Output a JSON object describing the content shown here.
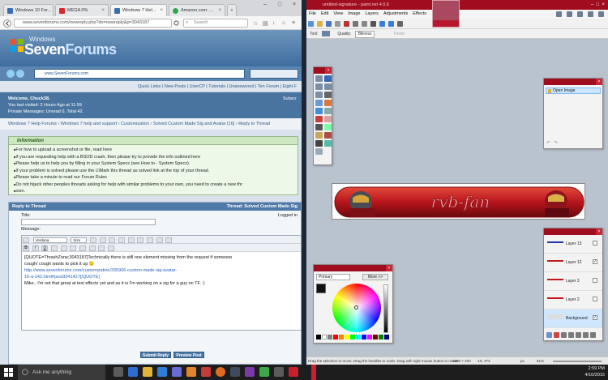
{
  "browser": {
    "tabs": [
      {
        "label": "Windows 10 For...",
        "color": "#3a6fb7"
      },
      {
        "label": "MEGA 0%",
        "color": "#d9272e"
      },
      {
        "label": "Windows 7 Hel...",
        "color": "#3a6fb7"
      },
      {
        "label": "Amazon.com: ...",
        "color": "#2ea44f"
      }
    ],
    "url": "www.sevenforums.com/newreply.php?do=newreply&p=3043187",
    "search_placeholder": "Search",
    "inner_url": "www.SevenForums.com"
  },
  "forum": {
    "logo_top": "Windows",
    "logo_main": "Seven",
    "logo_main2": "Forums",
    "nav": "Quick Links | New Posts | UserCP | Tutorials | Unanswered | Ten Forum | Eight F",
    "nav_extra": "Subscr",
    "welcome": "Welcome, Chuck38.",
    "last_visited": "You last visited: 2 Hours Ago at 11:59",
    "private_messages": "Private Messages: Unread 0, Total 42.",
    "breadcrumbs": "Windows 7 Help Forums › Windows 7 help and support › Customization › Solved Custom Made Sig and Avatar [16] › Reply to Thread",
    "info_title": "Information",
    "info_items": [
      "For how to upload a screenshot or file, read here",
      "If you are requesting help with a BSOD crash, then please try to provide the info outlined here",
      "Please help us to help you by filling in your System Specs (see How to - System Specs).",
      "If your problem is solved please use the ☑Mark this thread as solved link at the top of your thread.",
      "Please take a minute to read our Forum Rules",
      "Do not hijack other peoples threads asking for help with similar problems to your own, you need to create a new thr",
      "own."
    ],
    "reply_header": "Reply to Thread",
    "thread_label": "Thread: Solved Custom Made Sig",
    "title_label": "Title:",
    "logged_in": "Logged in",
    "message_label": "Message:",
    "font_select": "Verdana",
    "size_select": "Size",
    "message_lines": [
      "[QUOTE=ThrashZone;3043187]Technically there is still one element missing from the request if someone",
      "cough/ cough wants to pick it up 🙂",
      "http://www.sevenforums.com/customization/335906-custom-made-sig-avatar-",
      "16-a-142.html#post3041427[/QUOTE]",
      "Mike.. I'm not that great at text effects yet and as it is I'm working on a sig for a guy on TF. :)"
    ],
    "submit_label": "Submit Reply",
    "preview_label": "Preview Post"
  },
  "paint": {
    "title": "untitled-signature - paint.net 4.0.6",
    "menu": [
      "File",
      "Edit",
      "View",
      "Image",
      "Layers",
      "Adjustments",
      "Effects"
    ],
    "tool_label": "Tool:",
    "quality_label": "Quality:",
    "quality_value": "Bilinear",
    "finish_label": "Finish",
    "history_item": "Open Image",
    "color_primary": "Primary",
    "color_more": "More >>",
    "layers": [
      {
        "name": "Layer 13",
        "color": "#2233aa",
        "checked": false
      },
      {
        "name": "Layer 12",
        "color": "#c21a1a",
        "checked": true
      },
      {
        "name": "Layer 3",
        "color": "#c21a1a",
        "checked": false
      },
      {
        "name": "Layer 2",
        "color": "#c21a1a",
        "checked": false
      },
      {
        "name": "Background",
        "color": "#dddddd",
        "checked": true
      }
    ],
    "signature_text": "rvb-fan",
    "status_hint": "Drag the selection to move. Drag the handles to scale. Drag with right mouse button to rotate.",
    "status_size": "1400 × 200",
    "status_pos": "-18, 373",
    "status_units": "px",
    "status_zoom": "51%",
    "accent": "#9f0d1e"
  },
  "taskbar": {
    "search_placeholder": "Ask me anything",
    "time": "2:59 PM",
    "date": "4/10/2015"
  }
}
